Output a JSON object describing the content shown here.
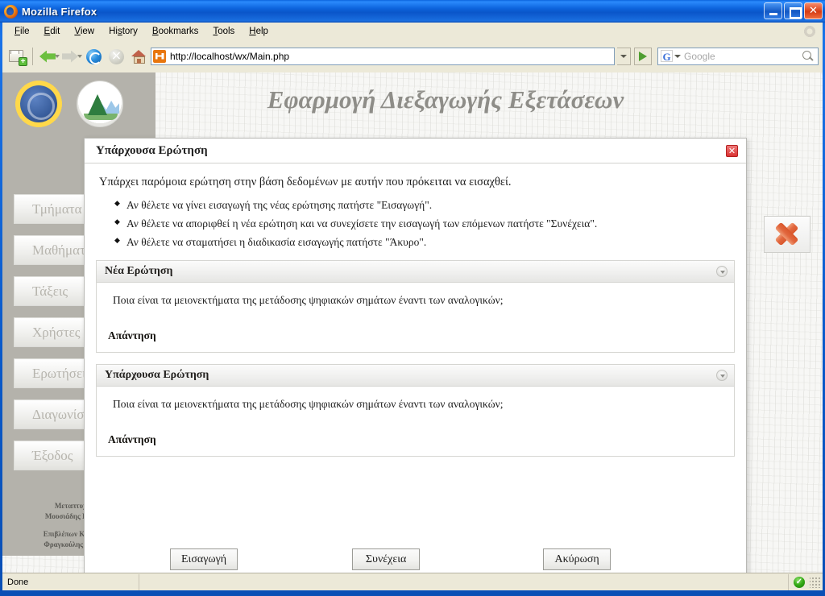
{
  "browser": {
    "window_title": "Mozilla Firefox",
    "app_icon": "firefox-icon",
    "window_buttons": {
      "minimize": "minimize-icon",
      "maximize": "maximize-icon",
      "close": "✕"
    },
    "menu": [
      {
        "label": "File",
        "accel": "F"
      },
      {
        "label": "Edit",
        "accel": "E"
      },
      {
        "label": "View",
        "accel": "V"
      },
      {
        "label": "History",
        "accel": "s"
      },
      {
        "label": "Bookmarks",
        "accel": "B"
      },
      {
        "label": "Tools",
        "accel": "T"
      },
      {
        "label": "Help",
        "accel": "H"
      }
    ],
    "toolbar": {
      "new_tab": "new-tab-icon",
      "back": "back-arrow-icon",
      "forward": "forward-arrow-icon",
      "reload": "reload-icon",
      "stop": "stop-icon",
      "home": "home-icon",
      "go": "go-icon"
    },
    "url": "http://localhost/wx/Main.php",
    "search": {
      "engine": "G",
      "placeholder": "Google"
    },
    "status": {
      "text": "Done",
      "security_icon": "secure-shield-icon"
    }
  },
  "page": {
    "title": "Εφαρμογή Διεξαγωγής Εξετάσεων",
    "logos": [
      {
        "name": "university-seal-logo"
      },
      {
        "name": "mountain-emblem-logo"
      }
    ],
    "sidebar": {
      "items": [
        {
          "label": "Τμήματα",
          "name": "sidebar-item-departments"
        },
        {
          "label": "Μαθήματα",
          "name": "sidebar-item-courses"
        },
        {
          "label": "Τάξεις",
          "name": "sidebar-item-classes"
        },
        {
          "label": "Χρήστες",
          "name": "sidebar-item-users"
        },
        {
          "label": "Ερωτήσεις",
          "name": "sidebar-item-questions"
        },
        {
          "label": "Διαγωνίσματα",
          "name": "sidebar-item-exams"
        },
        {
          "label": "Έξοδος",
          "name": "sidebar-item-logout"
        }
      ]
    },
    "credits": {
      "line1": "Μεταπτυχιακός",
      "line2": "Μουσιάδης Βασίλειος",
      "line3": "Επιβλέπων Καθηγητής",
      "line4": "Φραγκούλης Γεώργιος"
    },
    "close_x_button": "close-x-button"
  },
  "dialog": {
    "title": "Υπάρχουσα Ερώτηση",
    "close_label": "✕",
    "intro": "Υπάρχει παρόμοια ερώτηση στην βάση δεδομένων με αυτήν που πρόκειται να εισαχθεί.",
    "bullets": [
      "Αν θέλετε να γίνει εισαγωγή της νέας ερώτησης πατήστε \"Εισαγωγή\".",
      "Αν θέλετε να αποριφθεί η νέα ερώτηση και να συνεχίσετε την εισαγωγή των επόμενων πατήστε \"Συνέχεια\".",
      "Αν θέλετε να σταματήσει η διαδικασία εισαγωγής πατήστε \"Άκυρο\"."
    ],
    "panels": [
      {
        "title": "Νέα Ερώτηση",
        "question": "Ποια είναι τα μειονεκτήματα της μετάδοσης ψηφιακών σημάτων έναντι των αναλογικών;",
        "answer_label": "Απάντηση",
        "collapse_icon": "collapse-toggle-icon"
      },
      {
        "title": "Υπάρχουσα Ερώτηση",
        "question": "Ποια είναι τα μειονεκτήματα της μετάδοσης ψηφιακών σημάτων έναντι των αναλογικών;",
        "answer_label": "Απάντηση",
        "collapse_icon": "collapse-toggle-icon"
      }
    ],
    "buttons": {
      "insert": "Εισαγωγή",
      "continue": "Συνέχεια",
      "cancel": "Ακύρωση"
    }
  },
  "colors": {
    "titlebar_blue": "#0a59c9",
    "chrome_beige": "#ece9d8",
    "sidebar_grey": "#b4b2ab",
    "accent_red": "#d93232",
    "accent_orange": "#e2683f",
    "status_green": "#31a814"
  }
}
